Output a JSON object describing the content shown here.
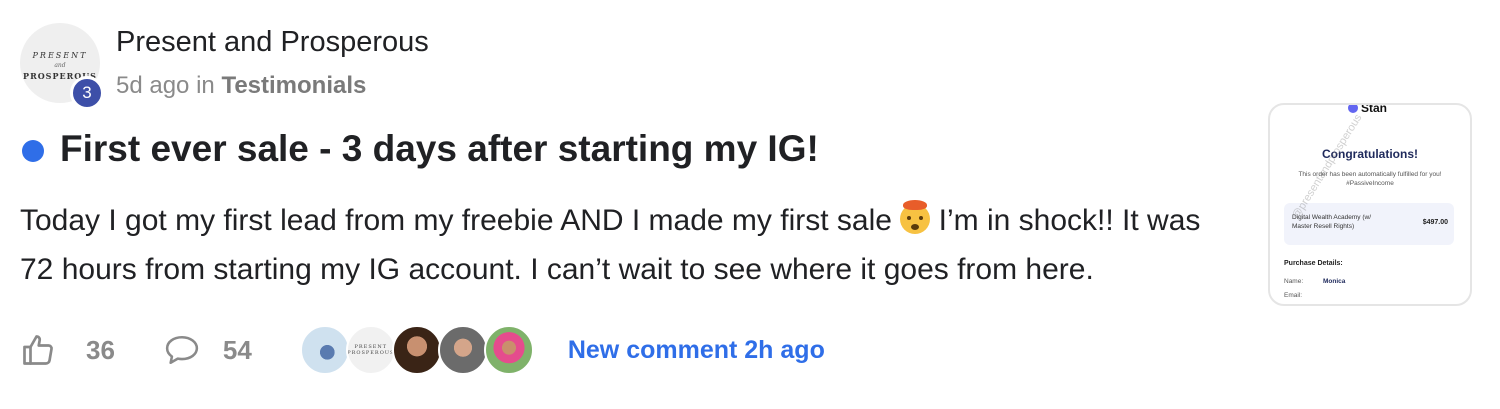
{
  "post": {
    "author": {
      "name": "Present and Prosperous",
      "avatar_logo": {
        "top": "PRESENT",
        "middle": "and",
        "bottom": "PROSPEROUS"
      },
      "level": "3"
    },
    "meta": {
      "time": "5d ago",
      "in_label": "in",
      "category": "Testimonials"
    },
    "title": "First ever sale - 3 days after starting my IG!",
    "body": {
      "before_emoji": "Today I got my first lead from my freebie AND I made my first sale",
      "after_emoji": "I’m in shock!! It was 72 hours from starting my IG account. I can’t wait to see where it goes from here."
    },
    "actions": {
      "likes": "36",
      "comments": "54",
      "new_comment": "New comment 2h ago"
    },
    "commenter_avatars": [
      "bird-photo-avatar",
      "present-prosperous-logo-avatar",
      "woman-avatar-1",
      "woman-avatar-2",
      "woman-avatar-3"
    ],
    "attachment": {
      "brand": "Stan",
      "heading": "Congratulations!",
      "message": "This order has been automatically fulfilled for you! #PassiveIncome",
      "product": "Digital Wealth Academy (w/ Master Resell Rights)",
      "price": "$497.00",
      "purchase_details_label": "Purchase Details:",
      "name_label": "Name:",
      "name_value": "Monica",
      "email_label": "Email:",
      "watermark": "@presentandprosperous"
    }
  },
  "colors": {
    "accent_blue": "#2f6ee8",
    "badge_indigo": "#3d4fa8",
    "muted_gray": "#8a8a8a"
  }
}
